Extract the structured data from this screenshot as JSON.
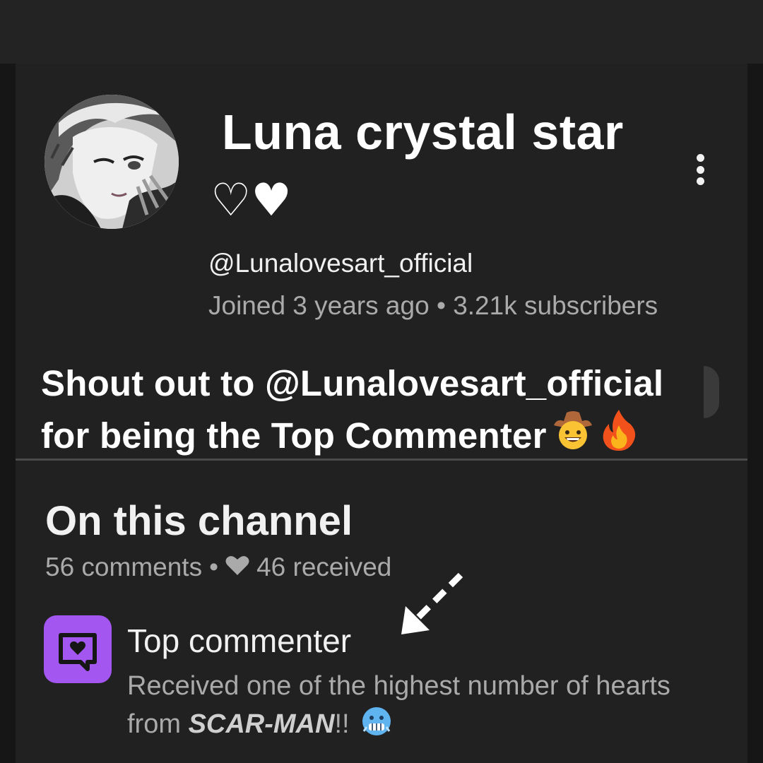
{
  "channel": {
    "name": "Luna crystal star",
    "name_suffix": "♡♥",
    "handle": "@Lunalovesart_official",
    "joined": "Joined 3 years ago",
    "separator": "•",
    "subscribers": "3.21k subscribers"
  },
  "overlay": {
    "shoutout_line1": "Shout out to @Lunalovesart_official",
    "shoutout_line2": "for being the Top Commenter",
    "emojis": [
      "cowboy-face-emoji",
      "fire-emoji"
    ]
  },
  "section": {
    "title": "On this channel",
    "comments": "56 comments",
    "separator": "•",
    "received": "46 received"
  },
  "badge": {
    "title": "Top commenter",
    "desc_line1": "Received one of the highest number of hearts",
    "desc_from": "from ",
    "desc_name": "SCAR-MAN",
    "desc_end": "!!",
    "emoji": "cold-face-emoji",
    "icon": "comment-heart-icon",
    "color": "#a357f0"
  },
  "colors": {
    "background": "#212121",
    "text_primary": "#f1f1f1",
    "text_secondary": "#aaaaaa"
  }
}
